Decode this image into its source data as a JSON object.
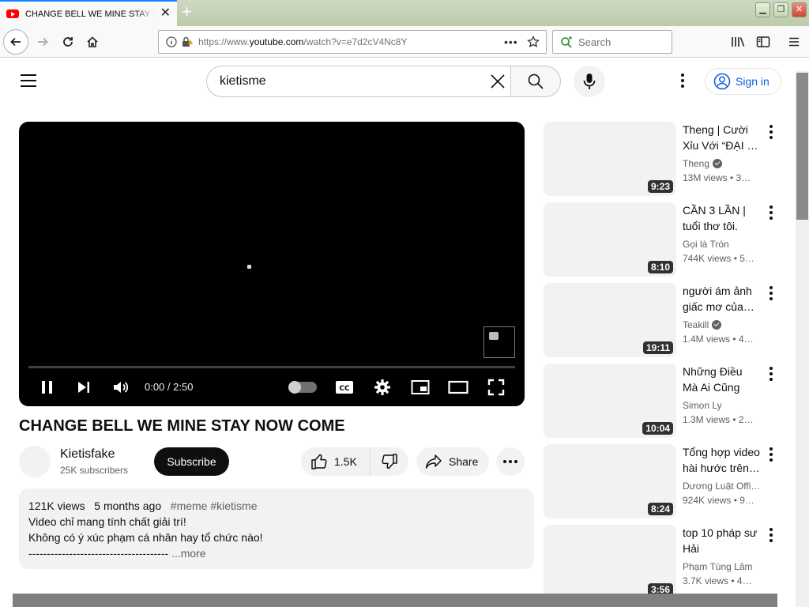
{
  "browser": {
    "tab_title": "CHANGE BELL WE MINE STAY NOW COME",
    "url_prefix": "https://www.",
    "url_domain": "youtube.com",
    "url_path": "/watch?v=e7d2cV4Nc8Y",
    "search_placeholder": "Search"
  },
  "header": {
    "search_query": "kietisme",
    "sign_in_label": "Sign in",
    "brand_color": "#065fd4"
  },
  "player": {
    "time_display": "0:00 / 2:50",
    "progress": 0
  },
  "video": {
    "title": "CHANGE BELL WE MINE STAY NOW COME",
    "channel": "Kietisfake",
    "subscribers": "25K subscribers",
    "subscribe_label": "Subscribe",
    "likes": "1.5K",
    "share_label": "Share"
  },
  "description": {
    "views": "121K views",
    "age": "5 months ago",
    "tags": "#meme #kietisme",
    "line1": "Video chỉ mang tính chất giải trí!",
    "line2": "Không có ý xúc phạm cá nhân hay tổ chức nào!",
    "line3": "--------------------------------------",
    "more": "...more"
  },
  "recommendations": [
    {
      "title": "Theng | Cười Xỉu Với “ĐẠI …",
      "channel": "Theng",
      "verified": true,
      "stats": "13M views  • 3…",
      "duration": "9:23"
    },
    {
      "title": "CẦN 3 LẦN | tuổi thơ tôi.",
      "channel": "Gọi là Tròn",
      "verified": false,
      "stats": "744K views  • 5…",
      "duration": "8:10"
    },
    {
      "title": "người ám ảnh giấc mơ của…",
      "channel": "Teakill",
      "verified": true,
      "stats": "1.4M views  • 4…",
      "duration": "19:11"
    },
    {
      "title": "Những Điều Mà Ai Cũng Làm…",
      "channel": "Simon Ly",
      "verified": false,
      "stats": "1.3M views  • 2…",
      "duration": "10:04"
    },
    {
      "title": "Tổng hợp video hài hước trên…",
      "channel": "Dương Luật Offi…",
      "verified": false,
      "stats": "924K views  • 9…",
      "duration": "8:24"
    },
    {
      "title": "top 10 pháp sư Hải",
      "channel": "Phạm Tùng Lâm",
      "verified": false,
      "stats": "3.7K views  • 4…",
      "duration": "3:56"
    }
  ]
}
